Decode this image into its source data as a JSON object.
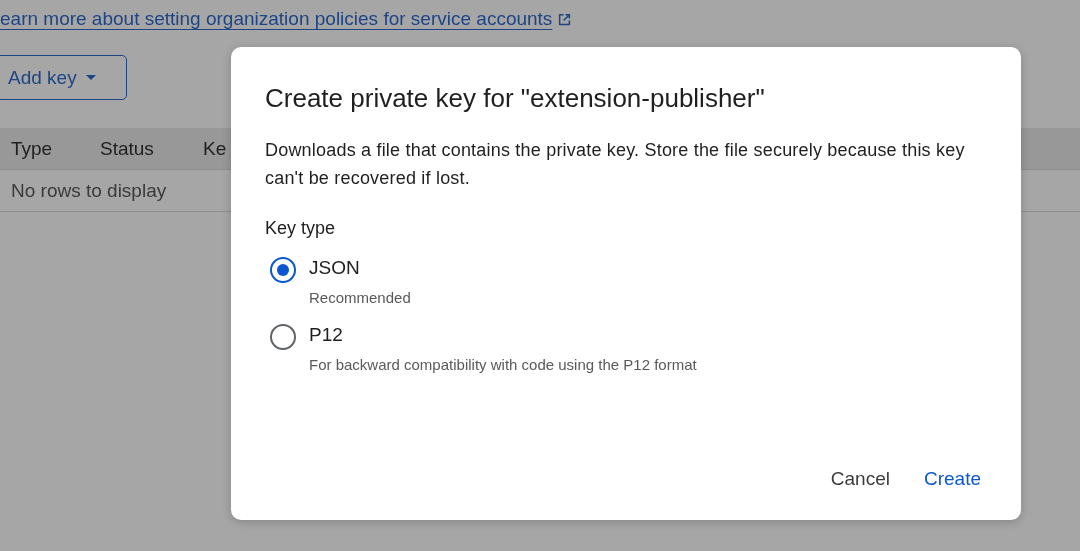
{
  "page": {
    "policy_link": "earn more about setting organization policies for service accounts",
    "add_key_button": "Add key",
    "table": {
      "columns": [
        "Type",
        "Status",
        "Ke"
      ],
      "empty_message": "No rows to display"
    }
  },
  "dialog": {
    "title": "Create private key for \"extension-publisher\"",
    "description": "Downloads a file that contains the private key. Store the file securely because this key can't be recovered if lost.",
    "key_type_label": "Key type",
    "options": [
      {
        "label": "JSON",
        "hint": "Recommended",
        "selected": true
      },
      {
        "label": "P12",
        "hint": "For backward compatibility with code using the P12 format",
        "selected": false
      }
    ],
    "buttons": [
      {
        "label": "Cancel",
        "kind": "secondary"
      },
      {
        "label": "Create",
        "kind": "primary"
      }
    ]
  }
}
